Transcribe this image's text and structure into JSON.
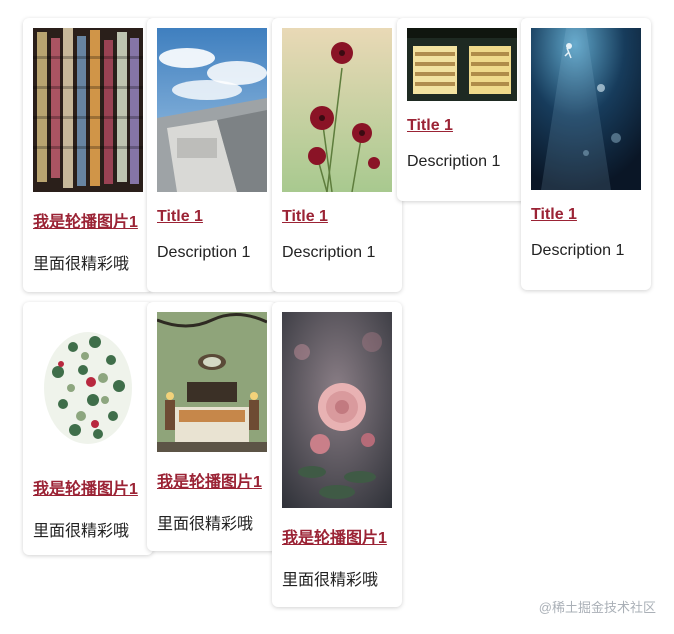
{
  "cards": [
    {
      "title": "我是轮播图片1",
      "desc": "里面很精彩哦",
      "image": "thread-spools-photo"
    },
    {
      "title": "Title 1",
      "desc": "Description 1",
      "image": "building-sky-photo"
    },
    {
      "title": "Title 1",
      "desc": "Description 1",
      "image": "red-flowers-photo"
    },
    {
      "title": "Title 1",
      "desc": "Description 1",
      "image": "bookstore-night-photo"
    },
    {
      "title": "Title 1",
      "desc": "Description 1",
      "image": "underwater-diver-photo"
    },
    {
      "title": "我是轮播图片1",
      "desc": "里面很精彩哦",
      "image": "floral-wreath-illustration"
    },
    {
      "title": "我是轮播图片1",
      "desc": "里面很精彩哦",
      "image": "bedroom-interior-photo"
    },
    {
      "title": "我是轮播图片1",
      "desc": "里面很精彩哦",
      "image": "pink-rose-photo"
    }
  ],
  "watermark": "@稀土掘金技术社区"
}
